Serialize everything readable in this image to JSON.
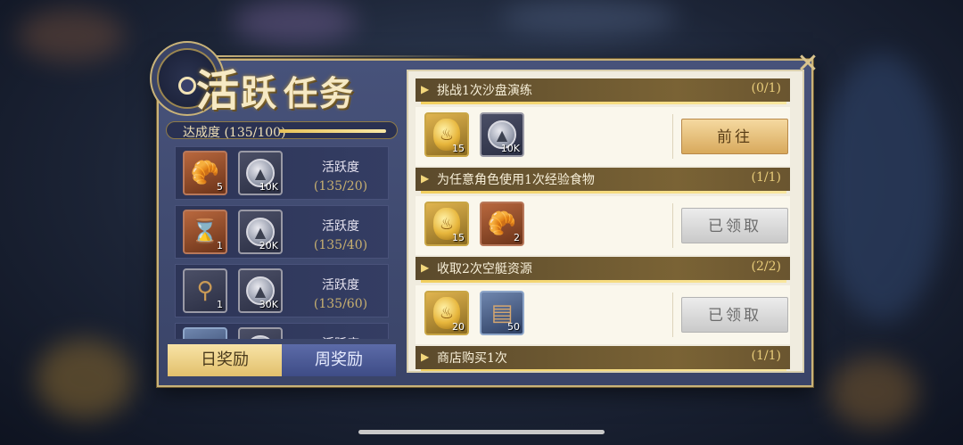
{
  "title": {
    "char1": "活",
    "char2": "跃",
    "rest": "任务"
  },
  "progress": {
    "label": "达成度 (135/100)",
    "fill_fraction": 1.0
  },
  "rewards": [
    {
      "items": [
        {
          "icon": "croissant",
          "qty": "5"
        },
        {
          "icon": "silver-coin",
          "qty": "10K"
        }
      ],
      "req_title": "活跃度",
      "req_value": "(135/20)"
    },
    {
      "items": [
        {
          "icon": "hourglass",
          "qty": "1"
        },
        {
          "icon": "silver-coin",
          "qty": "20K"
        }
      ],
      "req_title": "活跃度",
      "req_value": "(135/40)"
    },
    {
      "items": [
        {
          "icon": "spyglass",
          "qty": "1"
        },
        {
          "icon": "silver-coin",
          "qty": "30K"
        }
      ],
      "req_title": "活跃度",
      "req_value": "(135/60)"
    },
    {
      "items": [
        {
          "icon": "blue-crystal",
          "qty": ""
        },
        {
          "icon": "silver-coin",
          "qty": ""
        }
      ],
      "req_title": "活跃度",
      "req_value": ""
    }
  ],
  "tabs": {
    "daily": "日奖励",
    "weekly": "周奖励"
  },
  "tasks": [
    {
      "name": "挑战1次沙盘演练",
      "progress": "(0/1)",
      "items": [
        {
          "icon": "gold-medal",
          "qty": "15"
        },
        {
          "icon": "silver-coin",
          "qty": "10K"
        }
      ],
      "button": "前往",
      "state": "go"
    },
    {
      "name": "为任意角色使用1次经验食物",
      "progress": "(1/1)",
      "items": [
        {
          "icon": "gold-medal",
          "qty": "15"
        },
        {
          "icon": "croissant",
          "qty": "2"
        }
      ],
      "button": "已领取",
      "state": "done"
    },
    {
      "name": "收取2次空艇资源",
      "progress": "(2/2)",
      "items": [
        {
          "icon": "gold-medal",
          "qty": "20"
        },
        {
          "icon": "wood-planks",
          "qty": "50"
        }
      ],
      "button": "已领取",
      "state": "done"
    },
    {
      "name": "商店购买1次",
      "progress": "(1/1)",
      "items": [],
      "button": "",
      "state": "done"
    }
  ],
  "icons": {
    "close": "close-icon"
  }
}
